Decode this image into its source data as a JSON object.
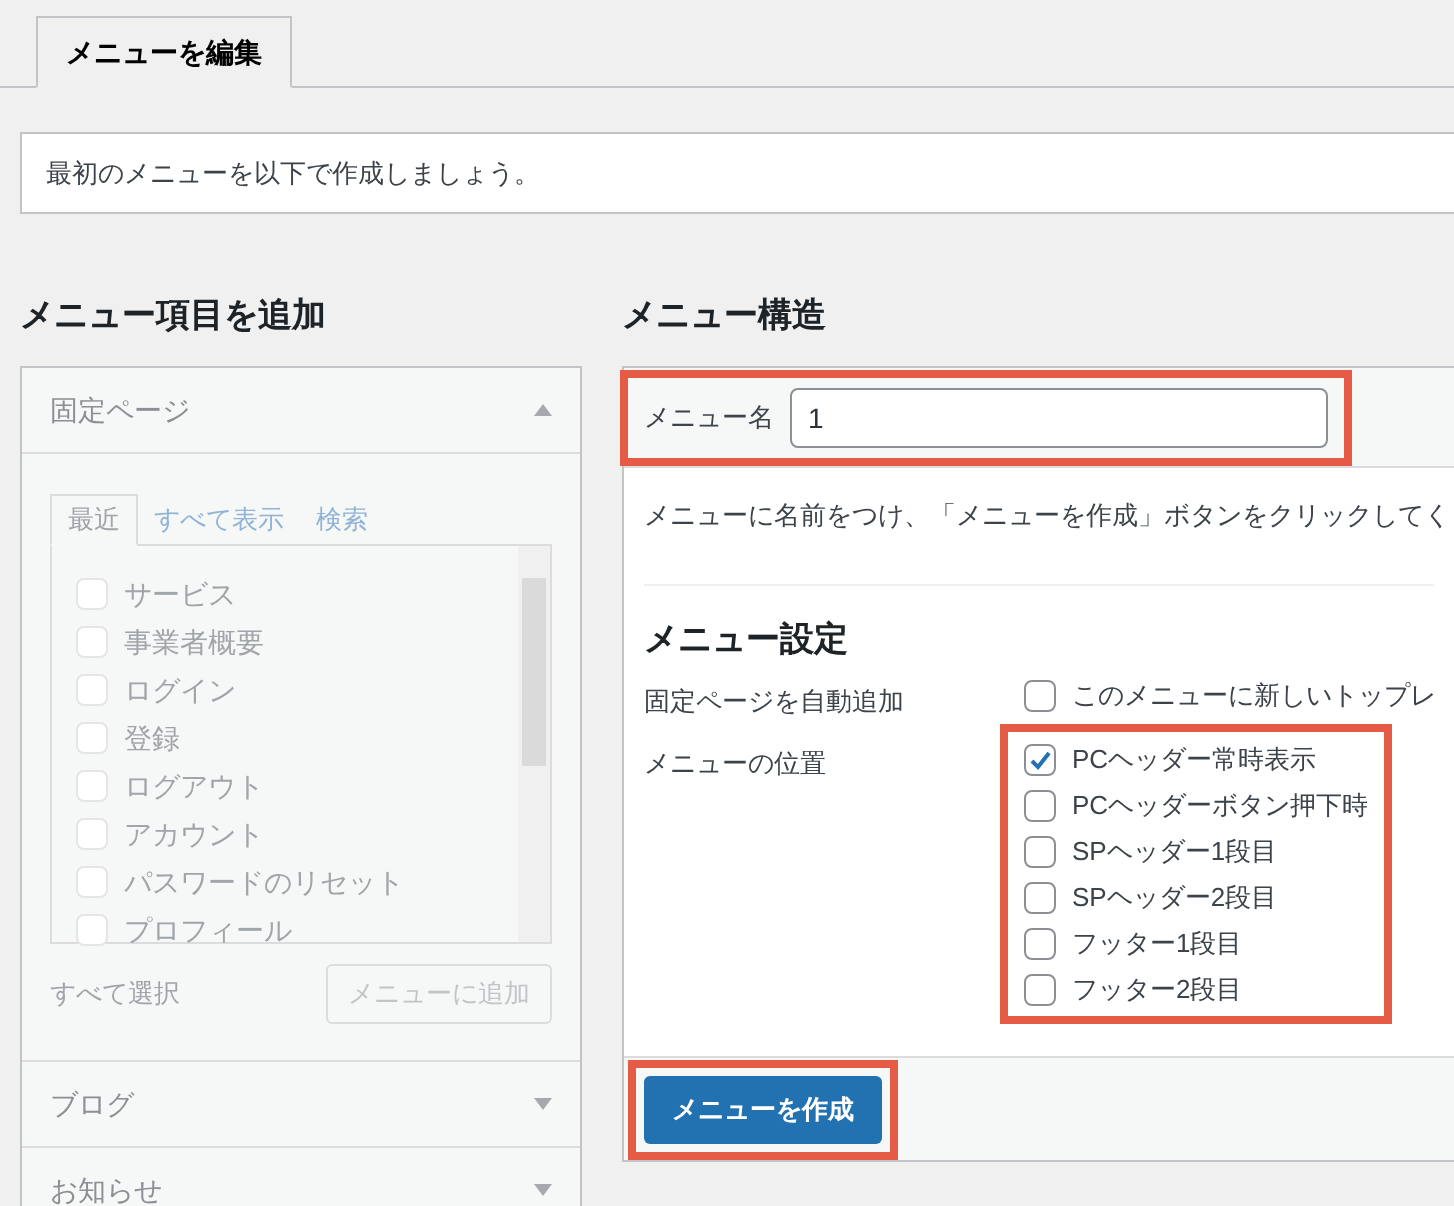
{
  "tabs": [
    {
      "label": "メニューを編集",
      "selected": true
    }
  ],
  "notice": "最初のメニューを以下で作成しましょう。",
  "add_items": {
    "heading": "メニュー項目を追加",
    "disabled": true,
    "sections": [
      {
        "title": "固定ページ",
        "expanded": true,
        "tabs": [
          {
            "label": "最近",
            "selected": true
          },
          {
            "label": "すべて表示",
            "selected": false
          },
          {
            "label": "検索",
            "selected": false
          }
        ],
        "items": [
          {
            "label": "サービス",
            "checked": false
          },
          {
            "label": "事業者概要",
            "checked": false
          },
          {
            "label": "ログイン",
            "checked": false
          },
          {
            "label": "登録",
            "checked": false
          },
          {
            "label": "ログアウト",
            "checked": false
          },
          {
            "label": "アカウント",
            "checked": false
          },
          {
            "label": "パスワードのリセット",
            "checked": false
          },
          {
            "label": "プロフィール",
            "checked": false
          }
        ],
        "select_all": "すべて選択",
        "add_button": "メニューに追加"
      },
      {
        "title": "ブログ",
        "expanded": false
      },
      {
        "title": "お知らせ",
        "expanded": false
      }
    ]
  },
  "structure": {
    "heading": "メニュー構造",
    "menu_name": {
      "label": "メニュー名",
      "value": "1",
      "highlighted": true
    },
    "instructions": "メニューに名前をつけ、「メニューを作成」ボタンをクリックしてく",
    "settings_heading": "メニュー設定",
    "settings": [
      {
        "label": "固定ページを自動追加",
        "highlighted": false,
        "options": [
          {
            "label": "このメニューに新しいトップレ",
            "checked": false
          }
        ]
      },
      {
        "label": "メニューの位置",
        "highlighted": true,
        "options": [
          {
            "label": "PCヘッダー常時表示",
            "checked": true
          },
          {
            "label": "PCヘッダーボタン押下時",
            "checked": false
          },
          {
            "label": "SPヘッダー1段目",
            "checked": false
          },
          {
            "label": "SPヘッダー2段目",
            "checked": false
          },
          {
            "label": "フッター1段目",
            "checked": false
          },
          {
            "label": "フッター2段目",
            "checked": false
          }
        ]
      }
    ],
    "create_button": {
      "label": "メニューを作成",
      "highlighted": true
    }
  }
}
